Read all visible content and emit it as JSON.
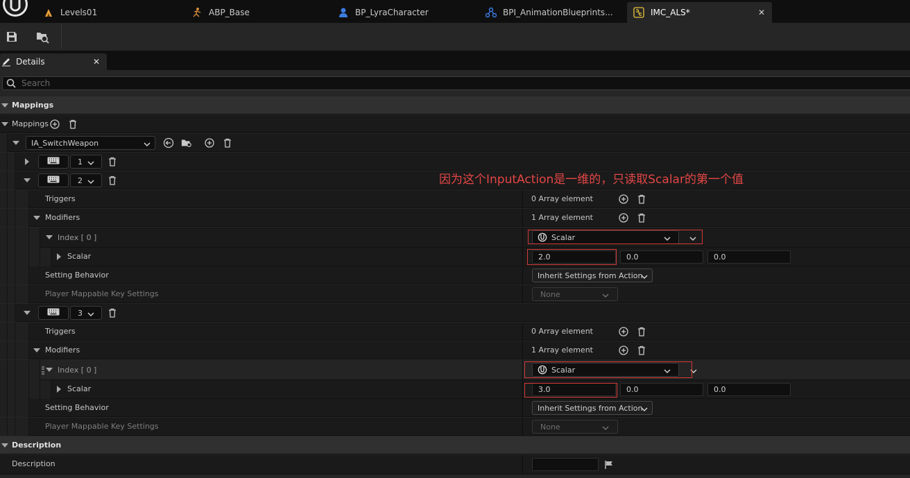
{
  "tabs": [
    {
      "label": "Levels01",
      "icon": "level-icon"
    },
    {
      "label": "ABP_Base",
      "icon": "animation-blueprint-icon"
    },
    {
      "label": "BP_LyraCharacter",
      "icon": "character-icon"
    },
    {
      "label": "BPI_AnimationBlueprints...",
      "icon": "blueprint-interface-icon"
    },
    {
      "label": "IMC_ALS*",
      "icon": "input-mapping-context-icon",
      "active": true
    }
  ],
  "details": {
    "tab_label": "Details",
    "search_placeholder": "Search"
  },
  "mappings_category": "Mappings",
  "mappings_label": "Mappings",
  "action": {
    "name": "IA_SwitchWeapon"
  },
  "key_rows": [
    {
      "index": "1",
      "expanded": false
    },
    {
      "index": "2",
      "expanded": true
    },
    {
      "index": "3",
      "expanded": true
    }
  ],
  "mapping2": {
    "triggers_label": "Triggers",
    "triggers_value": "0 Array element",
    "modifiers_label": "Modifiers",
    "modifiers_value": "1 Array element",
    "index_label": "Index [ 0 ]",
    "modifier_class": "Scalar",
    "scalar_label": "Scalar",
    "scalar_x": "2.0",
    "scalar_y": "0.0",
    "scalar_z": "0.0",
    "setting_behavior_label": "Setting Behavior",
    "setting_behavior_value": "Inherit Settings from Action",
    "player_mappable_label": "Player Mappable Key Settings",
    "player_mappable_value": "None"
  },
  "mapping3": {
    "triggers_label": "Triggers",
    "triggers_value": "0 Array element",
    "modifiers_label": "Modifiers",
    "modifiers_value": "1 Array element",
    "index_label": "Index [ 0 ]",
    "modifier_class": "Scalar",
    "scalar_label": "Scalar",
    "scalar_x": "3.0",
    "scalar_y": "0.0",
    "scalar_z": "0.0",
    "setting_behavior_label": "Setting Behavior",
    "setting_behavior_value": "Inherit Settings from Action",
    "player_mappable_label": "Player Mappable Key Settings",
    "player_mappable_value": "None"
  },
  "description_category": "Description",
  "description_label": "Description",
  "description_value": "",
  "annotation": "因为这个InputAction是一维的，只读取Scalar的第一个值",
  "colors": {
    "annotation_red": "#e54646",
    "panel_bg": "#262626",
    "row_bg": "#1a1a1a",
    "field_bg": "#0f0f0f",
    "ue_blue": "#3b7be0"
  }
}
